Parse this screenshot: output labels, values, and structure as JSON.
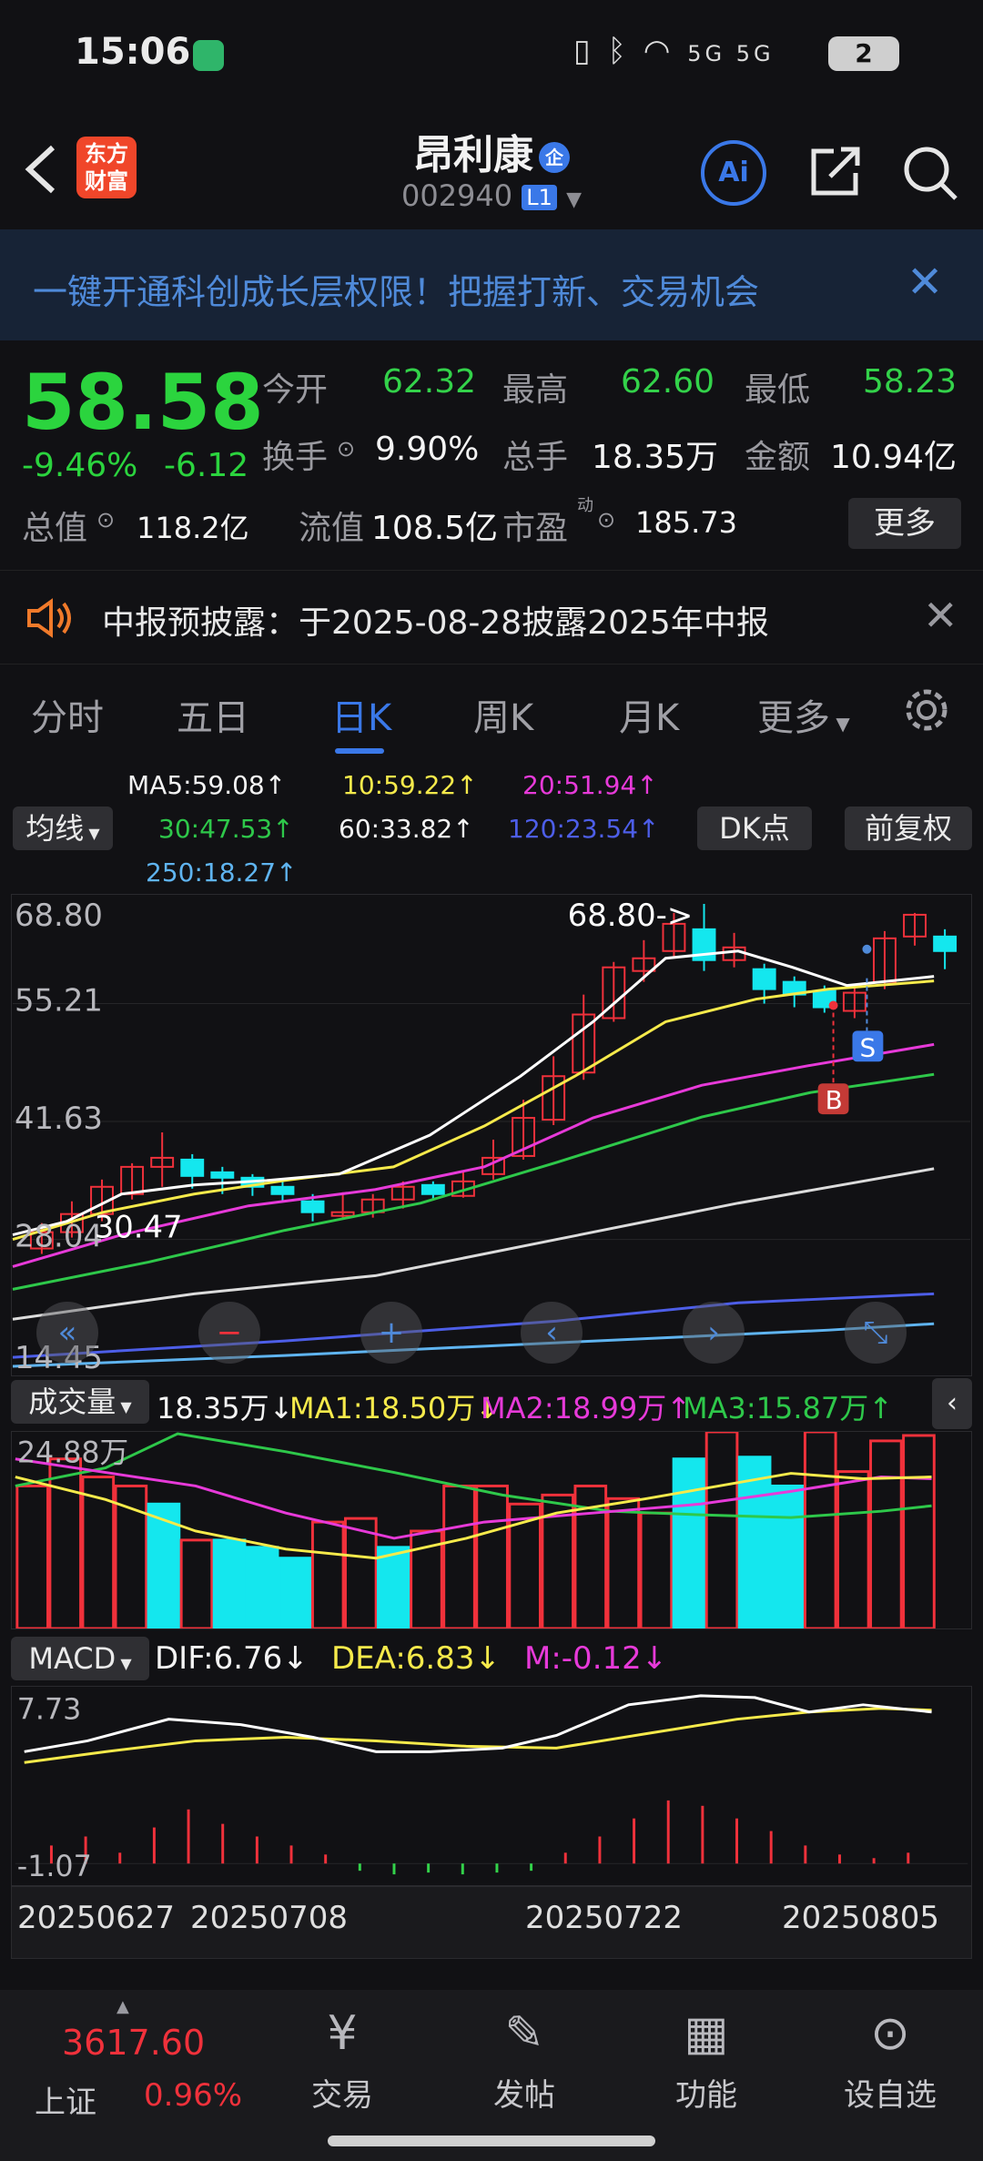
{
  "status_bar": {
    "time": "15:06",
    "signal_text": "5G 5G",
    "battery": "2"
  },
  "header": {
    "logo_text": "东方财富",
    "stock_name": "昂利康",
    "badge": "企",
    "code": "002940",
    "market_badge": "L1",
    "ai_label": "Ai"
  },
  "banner": {
    "text": "一键开通科创成长层权限！把握打新、交易机会"
  },
  "quote": {
    "price": "58.58",
    "change_pct": "-9.46%",
    "change_abs": "-6.12",
    "fields": [
      {
        "label": "今开",
        "value": "62.32",
        "color": "green"
      },
      {
        "label": "最高",
        "value": "62.60",
        "color": "green"
      },
      {
        "label": "最低",
        "value": "58.23",
        "color": "green"
      },
      {
        "label": "换手",
        "value": "9.90%",
        "color": "white"
      },
      {
        "label": "总手",
        "value": "18.35万",
        "color": "white"
      },
      {
        "label": "金额",
        "value": "10.94亿",
        "color": "white"
      },
      {
        "label": "总值",
        "value": "118.2亿",
        "color": "white"
      },
      {
        "label": "流值",
        "value": "108.5亿",
        "color": "white"
      },
      {
        "label": "市盈",
        "value": "185.73",
        "color": "white"
      }
    ],
    "pe_sup": "动",
    "more_button": "更多"
  },
  "notice": {
    "text": "中报预披露：于2025-08-28披露2025年中报"
  },
  "tabs": [
    "分时",
    "五日",
    "日K",
    "周K",
    "月K",
    "更多"
  ],
  "active_tab": "日K",
  "ma_header": {
    "ma_button": "均线",
    "ma5": "MA5:59.08↑",
    "ma10": "10:59.22↑",
    "ma20": "20:51.94↑",
    "ma30": "30:47.53↑",
    "ma60": "60:33.82↑",
    "ma120": "120:23.54↑",
    "ma250": "250:18.27↑",
    "dk_button": "DK点",
    "fq_button": "前复权"
  },
  "kchart": {
    "y_labels": [
      "68.80",
      "55.21",
      "41.63",
      "28.04",
      "14.45"
    ],
    "max_annotation": "68.80->",
    "min_annotation": "30.47",
    "buy_mark": "B",
    "sell_mark": "S",
    "colors": {
      "up": "#f0313b",
      "down": "#14e7ee",
      "ma5": "#ffffff",
      "ma10": "#f6ea4b",
      "ma20": "#e73ad9",
      "ma30": "#2ec84a",
      "ma60": "#dcdcdc",
      "ma120": "#4d5ee8",
      "ma250": "#5fb4f0"
    }
  },
  "volume": {
    "button": "成交量",
    "vol": "18.35万↓",
    "ma1": "MA1:18.50万↓",
    "ma2": "MA2:18.99万↑",
    "ma3": "MA3:15.87万↑",
    "y_label": "24.88万"
  },
  "macd": {
    "button": "MACD",
    "dif": "DIF:6.76↓",
    "dea": "DEA:6.83↓",
    "m": "M:-0.12↓",
    "y_top": "7.73",
    "y_bottom": "-1.07"
  },
  "dates": [
    "20250627",
    "20250708",
    "20250722",
    "20250805"
  ],
  "bottom_nav": {
    "index_value": "3617.60",
    "index_name": "上证",
    "index_pct": "0.96%",
    "items": [
      "交易",
      "发帖",
      "功能",
      "设自选"
    ]
  }
}
